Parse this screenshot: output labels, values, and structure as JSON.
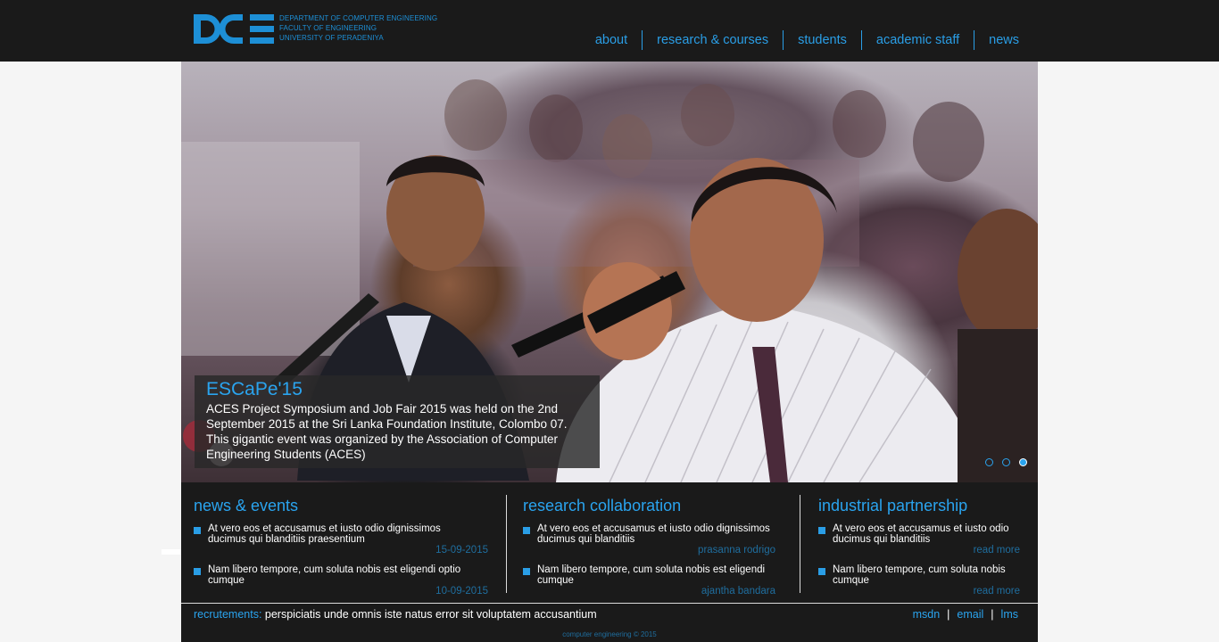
{
  "brand": {
    "logo_letters": "DCE",
    "lines": [
      "DEPARTMENT OF COMPUTER ENGINEERING",
      "FACULTY OF ENGINEERING",
      "UNIVERSITY OF PERADENIYA"
    ],
    "accent": "#1d8fd6"
  },
  "nav": {
    "items": [
      "about",
      "research & courses",
      "students",
      "academic staff",
      "news"
    ]
  },
  "hero": {
    "title": "ESCaPe'15",
    "body": "ACES Project Symposium and Job Fair 2015 was held on the 2nd September 2015 at the Sri Lanka Foundation Institute, Colombo 07. This gigantic event was organized by the Association of Computer Engineering Students (ACES)",
    "slide_count": 3,
    "active_slide": 3
  },
  "sections": {
    "news": {
      "heading": "news & events",
      "items": [
        {
          "text": "At vero eos et accusamus et iusto odio dignissimos ducimus qui blanditiis praesentium",
          "meta": "15-09-2015"
        },
        {
          "text": "Nam libero tempore, cum soluta nobis est eligendi optio cumque",
          "meta": "10-09-2015"
        }
      ]
    },
    "research": {
      "heading": "research collaboration",
      "items": [
        {
          "text": "At vero eos et accusamus et iusto odio dignissimos ducimus qui blanditiis",
          "meta": "prasanna rodrigo"
        },
        {
          "text": "Nam libero tempore, cum soluta nobis est eligendi cumque",
          "meta": "ajantha bandara"
        }
      ]
    },
    "industry": {
      "heading": "industrial partnership",
      "items": [
        {
          "text": "At vero eos et accusamus et iusto odio ducimus qui blanditiis",
          "meta": "read more"
        },
        {
          "text": "Nam libero tempore, cum soluta nobis cumque",
          "meta": "read more"
        }
      ]
    }
  },
  "footer": {
    "recruit_label": "recrutements:",
    "recruit_text": "perspiciatis unde omnis iste natus error sit voluptatem accusantium",
    "links": [
      "msdn",
      "email",
      "lms"
    ],
    "separator": "|",
    "copyright": "computer engineering © 2015"
  }
}
